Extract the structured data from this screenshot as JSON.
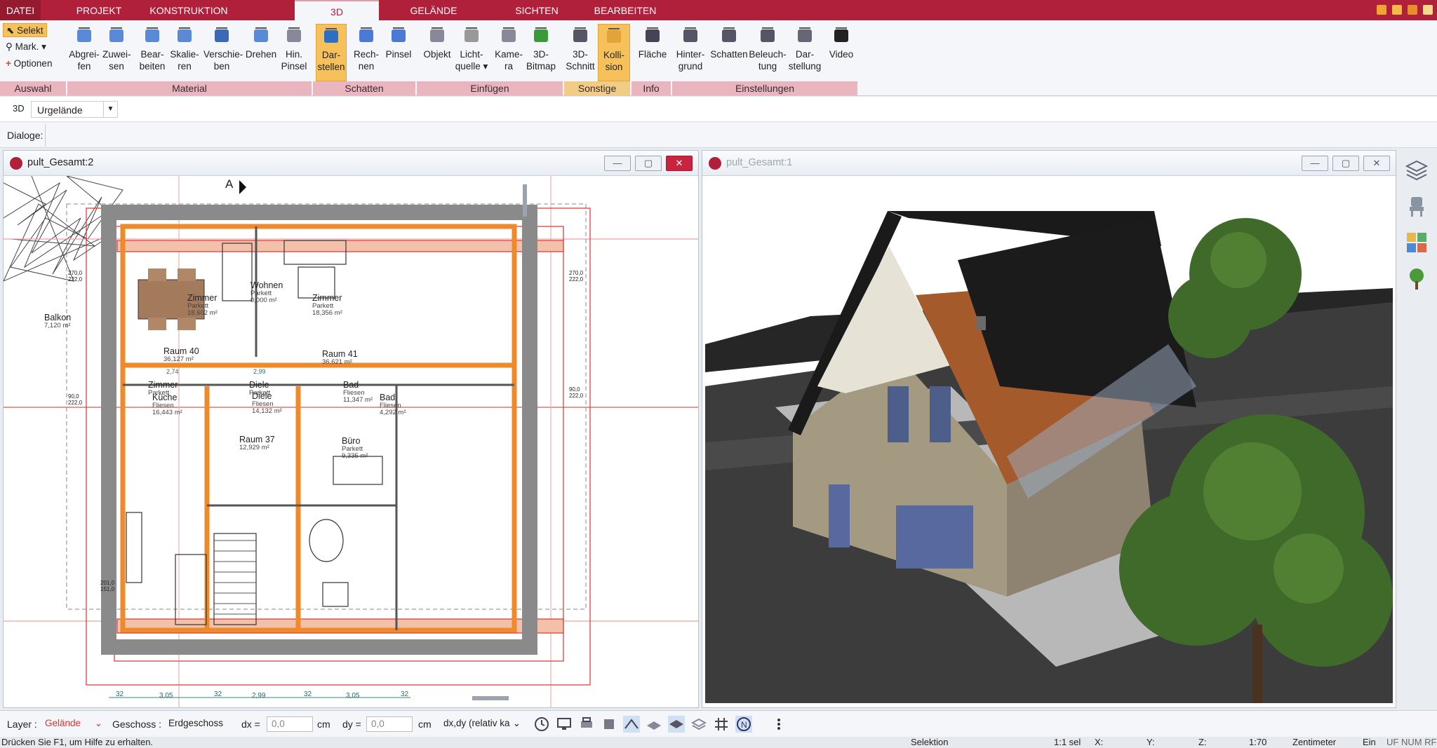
{
  "tabs": [
    {
      "label": "DATEI"
    },
    {
      "label": "PROJEKT"
    },
    {
      "label": "KONSTRUKTION"
    },
    {
      "label": "3D"
    },
    {
      "label": "GELÄNDE"
    },
    {
      "label": "SICHTEN"
    },
    {
      "label": "BEARBEITEN"
    }
  ],
  "selection_tools": {
    "select": "Selekt",
    "mark": "Mark.",
    "options": "Optionen"
  },
  "ribbon": {
    "buttons": [
      {
        "line1": "Abgrei-",
        "line2": "fen"
      },
      {
        "line1": "Zuwei-",
        "line2": "sen"
      },
      {
        "line1": "Bear-",
        "line2": "beiten"
      },
      {
        "line1": "Skalie-",
        "line2": "ren"
      },
      {
        "line1": "Verschie-",
        "line2": "ben"
      },
      {
        "line1": "Drehen",
        "line2": ""
      },
      {
        "line1": "Hin.",
        "line2": "Pinsel"
      },
      {
        "line1": "Dar-",
        "line2": "stellen"
      },
      {
        "line1": "Rech-",
        "line2": "nen"
      },
      {
        "line1": "Pinsel",
        "line2": ""
      },
      {
        "line1": "Objekt",
        "line2": ""
      },
      {
        "line1": "Licht-",
        "line2": "quelle ▾"
      },
      {
        "line1": "Kame-",
        "line2": "ra"
      },
      {
        "line1": "3D-",
        "line2": "Bitmap"
      },
      {
        "line1": "3D-",
        "line2": "Schnitt"
      },
      {
        "line1": "Kolli-",
        "line2": "sion"
      },
      {
        "line1": "Fläche",
        "line2": ""
      },
      {
        "line1": "Hinter-",
        "line2": "grund"
      },
      {
        "line1": "Schatten",
        "line2": ""
      },
      {
        "line1": "Beleuch-",
        "line2": "tung"
      },
      {
        "line1": "Dar-",
        "line2": "stellung"
      },
      {
        "line1": "Video",
        "line2": ""
      }
    ],
    "groups": [
      {
        "label": "Auswahl"
      },
      {
        "label": "Material"
      },
      {
        "label": "Schatten"
      },
      {
        "label": "Einfügen"
      },
      {
        "label": "Sonstige"
      },
      {
        "label": "Info"
      },
      {
        "label": "Einstellungen"
      }
    ]
  },
  "row2": {
    "mode": "3D",
    "terrain": "Urgelände"
  },
  "row3": {
    "dialogs": "Dialoge:"
  },
  "plan_window": {
    "title": "pult_Gesamt:2",
    "rooms": [
      {
        "name": "Zimmer",
        "type": "Parkett",
        "area": "18,602 m²"
      },
      {
        "name": "Wohnen",
        "type": "Parkett",
        "area": "0,000 m²"
      },
      {
        "name": "Zimmer",
        "type": "Parkett",
        "area": "18,356 m²"
      },
      {
        "name": "Balkon",
        "type": "",
        "area": "7,120 m²"
      },
      {
        "name": "Raum 40",
        "type": "",
        "area": "36,127 m²"
      },
      {
        "name": "Raum 41",
        "type": "",
        "area": "36,621 m²"
      },
      {
        "name": "Zimmer",
        "type": "Parkett",
        "area": ""
      },
      {
        "name": "Küche",
        "type": "Fliesen",
        "area": "16,443 m²"
      },
      {
        "name": "Diele",
        "type": "Parkett",
        "area": ""
      },
      {
        "name": "Diele",
        "type": "Fliesen",
        "area": "14,132 m²"
      },
      {
        "name": "Bad",
        "type": "Fliesen",
        "area": "11,347 m²"
      },
      {
        "name": "Bad",
        "type": "Fliesen",
        "area": "4,292 m²"
      },
      {
        "name": "Raum 37",
        "type": "",
        "area": "12,929 m²"
      },
      {
        "name": "Büro",
        "type": "Parkett",
        "area": "9,335 m²"
      }
    ],
    "dimensions": [
      "3,05",
      "2,99",
      "3,05",
      "2,74",
      "2,99",
      "270,0",
      "222,0",
      "90,0",
      "222,0",
      "201,0",
      "151,0",
      "32",
      "32",
      "32",
      "32"
    ],
    "section_marker": "A"
  },
  "view3d_window": {
    "title": "pult_Gesamt:1"
  },
  "status": {
    "layer_label": "Layer :",
    "layer_value": "Gelände",
    "floor_label": "Geschoss :",
    "floor_value": "Erdgeschoss",
    "dx_label": "dx =",
    "dx_value": "0,0",
    "dx_unit": "cm",
    "dy_label": "dy =",
    "dy_value": "0,0",
    "dy_unit": "cm",
    "mode_value": "dx,dy (relativ ka"
  },
  "hint": {
    "help": "Drücken Sie F1, um Hilfe zu erhalten.",
    "selection": "Selektion",
    "sel_count": "1:1 sel",
    "x": "X:",
    "y": "Y:",
    "z": "Z:",
    "scale": "1:70",
    "unit": "Zentimeter",
    "lang": "Ein",
    "flags": "UF NUM RF"
  },
  "colors": {
    "brand": "#b1203a",
    "ribbon_group": "#e9b6c0",
    "highlight": "#f6c15a",
    "wall": "#8a8a8a",
    "orange": "#ee8a2a"
  }
}
